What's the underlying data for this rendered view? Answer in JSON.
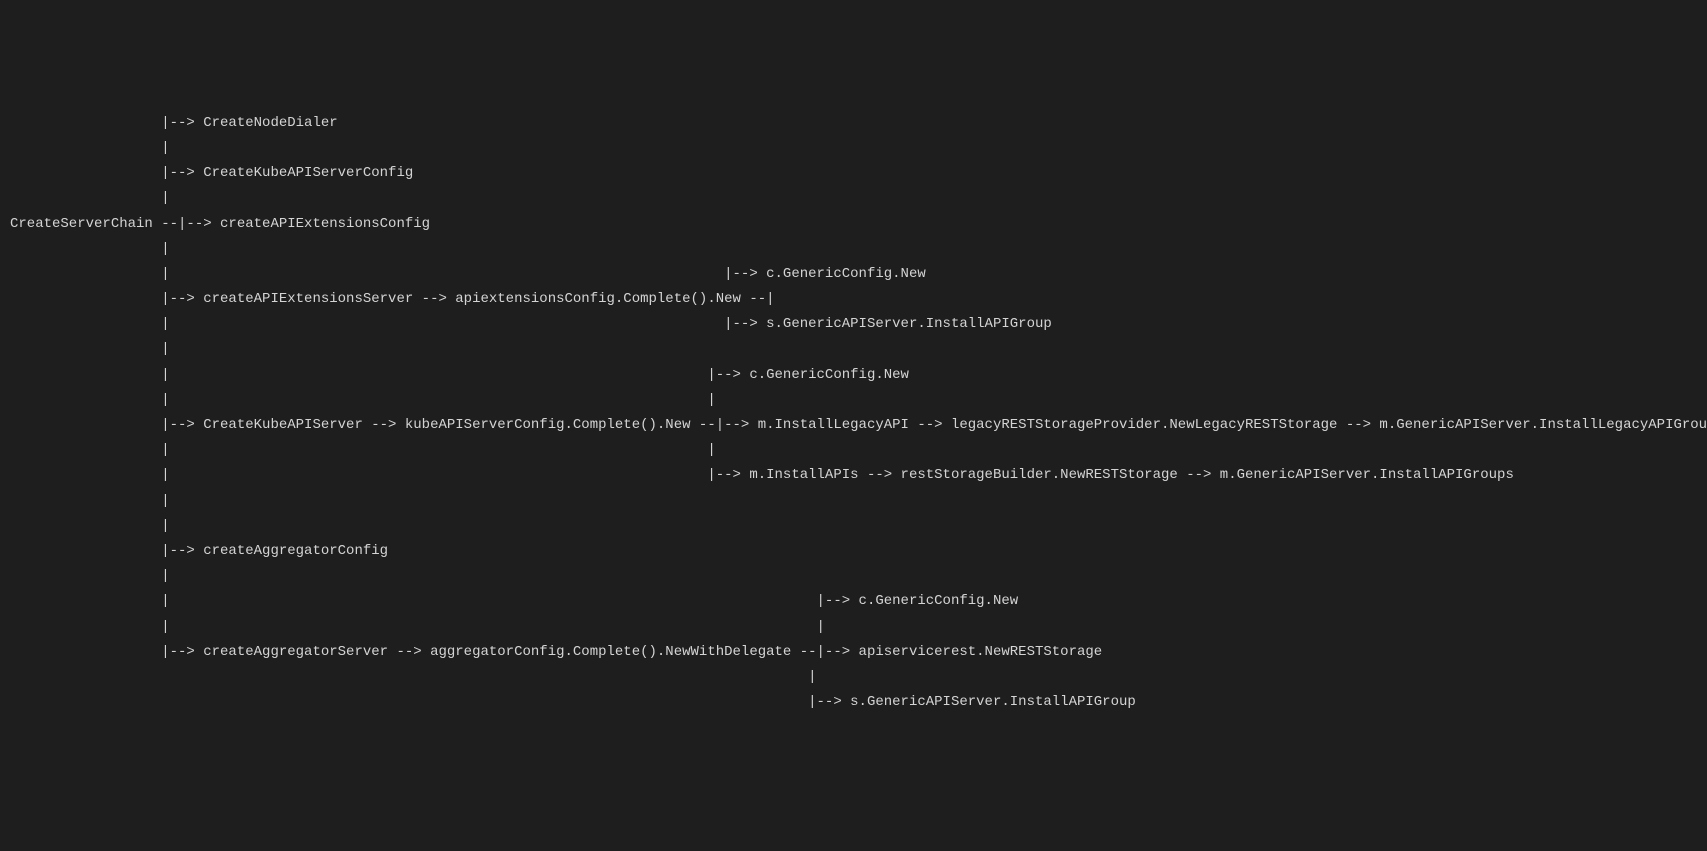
{
  "diagram": {
    "lines": [
      "                  |--> CreateNodeDialer",
      "                  |",
      "                  |--> CreateKubeAPIServerConfig",
      "                  |",
      "CreateServerChain --|--> createAPIExtensionsConfig",
      "                  |",
      "                  |                                                                  |--> c.GenericConfig.New",
      "                  |--> createAPIExtensionsServer --> apiextensionsConfig.Complete().New --|",
      "                  |                                                                  |--> s.GenericAPIServer.InstallAPIGroup",
      "                  |",
      "                  |                                                                |--> c.GenericConfig.New",
      "                  |                                                                |",
      "                  |--> CreateKubeAPIServer --> kubeAPIServerConfig.Complete().New --|--> m.InstallLegacyAPI --> legacyRESTStorageProvider.NewLegacyRESTStorage --> m.GenericAPIServer.InstallLegacyAPIGroup",
      "                  |                                                                |",
      "                  |                                                                |--> m.InstallAPIs --> restStorageBuilder.NewRESTStorage --> m.GenericAPIServer.InstallAPIGroups",
      "                  |",
      "                  |",
      "                  |--> createAggregatorConfig",
      "                  |",
      "                  |                                                                             |--> c.GenericConfig.New",
      "                  |                                                                             |",
      "                  |--> createAggregatorServer --> aggregatorConfig.Complete().NewWithDelegate --|--> apiservicerest.NewRESTStorage",
      "                                                                                               |",
      "                                                                                               |--> s.GenericAPIServer.InstallAPIGroup"
    ]
  }
}
